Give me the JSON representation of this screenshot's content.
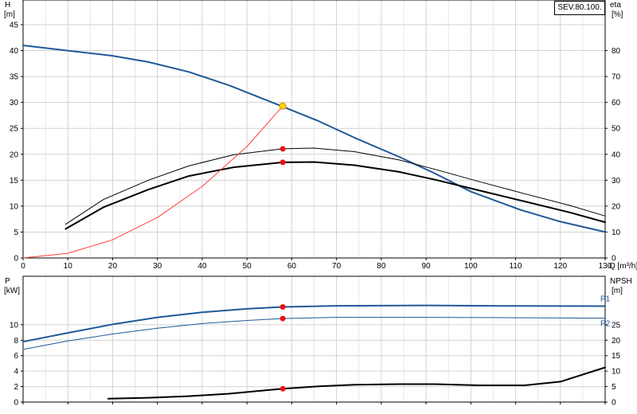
{
  "pump_label": "SEV.80.100.",
  "chart_data": [
    {
      "type": "line",
      "title": "",
      "x_axis": {
        "label": "Q [m³/h]",
        "range": [
          0,
          130
        ],
        "ticks": [
          0,
          10,
          20,
          30,
          40,
          50,
          60,
          70,
          80,
          90,
          100,
          110,
          120,
          130
        ]
      },
      "y_left": {
        "label": "H",
        "unit": "[m]",
        "range": [
          0,
          45
        ],
        "ticks": [
          0,
          5,
          10,
          15,
          20,
          25,
          30,
          35,
          40,
          45
        ]
      },
      "y_right": {
        "label": "eta",
        "unit": "[%]",
        "range": [
          0,
          90
        ],
        "ticks": [
          0,
          10,
          20,
          30,
          40,
          50,
          60,
          70,
          80
        ]
      },
      "grid": true,
      "series": [
        {
          "id": "head",
          "axis": "left",
          "color": "#1f5a96",
          "width": 2,
          "x": [
            0,
            10,
            20,
            28,
            37,
            46,
            58,
            66,
            74,
            84,
            92,
            100,
            111,
            120,
            130
          ],
          "y": [
            41,
            40,
            39,
            37.8,
            35.9,
            33.3,
            29.2,
            26.4,
            23.2,
            19.5,
            16.3,
            12.8,
            9.3,
            7,
            5
          ]
        },
        {
          "id": "eta-upper",
          "axis": "right",
          "color": "#000000",
          "width": 1,
          "x": [
            9.5,
            18,
            28,
            37,
            47,
            58,
            65,
            74,
            84,
            92,
            102,
            112,
            122,
            130
          ],
          "y": [
            13,
            22.6,
            30,
            35.5,
            39.8,
            42.1,
            42.4,
            41,
            37.8,
            34.2,
            29.4,
            24.8,
            20.3,
            16.2
          ]
        },
        {
          "id": "eta-lower",
          "axis": "right",
          "color": "#000000",
          "width": 2,
          "x": [
            9.5,
            18,
            28,
            37,
            47,
            58,
            65,
            74,
            84,
            92,
            102,
            112,
            122,
            130
          ],
          "y": [
            11.2,
            19.6,
            26.4,
            31.6,
            35,
            36.9,
            37,
            35.8,
            33.2,
            30.2,
            26,
            21.8,
            17.6,
            13.8
          ]
        },
        {
          "id": "system-curve",
          "axis": "left",
          "color": "#ff4040",
          "width": 1,
          "x": [
            0,
            10,
            20,
            30,
            40,
            50,
            58
          ],
          "y": [
            0,
            0.9,
            3.5,
            7.8,
            13.8,
            21.5,
            29.3
          ]
        }
      ],
      "points": [
        {
          "axis": "left",
          "x": 58,
          "y": 29.3,
          "color": "#ffd700",
          "stroke": "#e08a00"
        },
        {
          "axis": "right",
          "x": 58,
          "y": 42.1,
          "color": "#ee1111"
        },
        {
          "axis": "right",
          "x": 58,
          "y": 36.9,
          "color": "#ee1111"
        }
      ]
    },
    {
      "type": "line",
      "title": "",
      "x_axis": {
        "range": [
          0,
          130
        ]
      },
      "y_left": {
        "label": "P",
        "unit": "[kW]",
        "range": [
          0,
          14
        ],
        "ticks": [
          0,
          2,
          4,
          6,
          8,
          10
        ]
      },
      "y_right": {
        "label": "NPSH",
        "unit": "[m]",
        "range": [
          0,
          35
        ],
        "ticks": [
          0,
          5,
          10,
          15,
          20,
          25
        ]
      },
      "grid": true,
      "series": [
        {
          "id": "P1",
          "name": "P1",
          "axis": "left",
          "color": "#1f5a96",
          "width": 2,
          "x": [
            0,
            10,
            20,
            30,
            40,
            50,
            58,
            70,
            90,
            110,
            130
          ],
          "y": [
            7.8,
            8.95,
            10.05,
            10.95,
            11.6,
            12.05,
            12.3,
            12.45,
            12.5,
            12.42,
            12.4
          ]
        },
        {
          "id": "P2",
          "name": "P2",
          "axis": "left",
          "color": "#1f5a96",
          "width": 1,
          "x": [
            0,
            10,
            20,
            30,
            40,
            50,
            58,
            70,
            90,
            110,
            130
          ],
          "y": [
            6.8,
            7.9,
            8.8,
            9.55,
            10.15,
            10.55,
            10.8,
            10.95,
            10.95,
            10.9,
            10.85
          ]
        },
        {
          "id": "npsh",
          "axis": "right",
          "color": "#000000",
          "width": 2,
          "x": [
            19,
            28,
            37,
            46,
            58,
            66,
            74,
            84,
            92,
            102,
            112,
            120,
            130
          ],
          "y": [
            1.1,
            1.4,
            1.9,
            2.7,
            4.3,
            5.1,
            5.6,
            5.8,
            5.8,
            5.4,
            5.4,
            6.6,
            11.2
          ]
        }
      ],
      "points": [
        {
          "axis": "left",
          "x": 58,
          "y": 12.3,
          "color": "#ee1111"
        },
        {
          "axis": "left",
          "x": 58,
          "y": 10.8,
          "color": "#ee1111"
        },
        {
          "axis": "right",
          "x": 58,
          "y": 4.3,
          "color": "#ee1111"
        }
      ]
    }
  ]
}
